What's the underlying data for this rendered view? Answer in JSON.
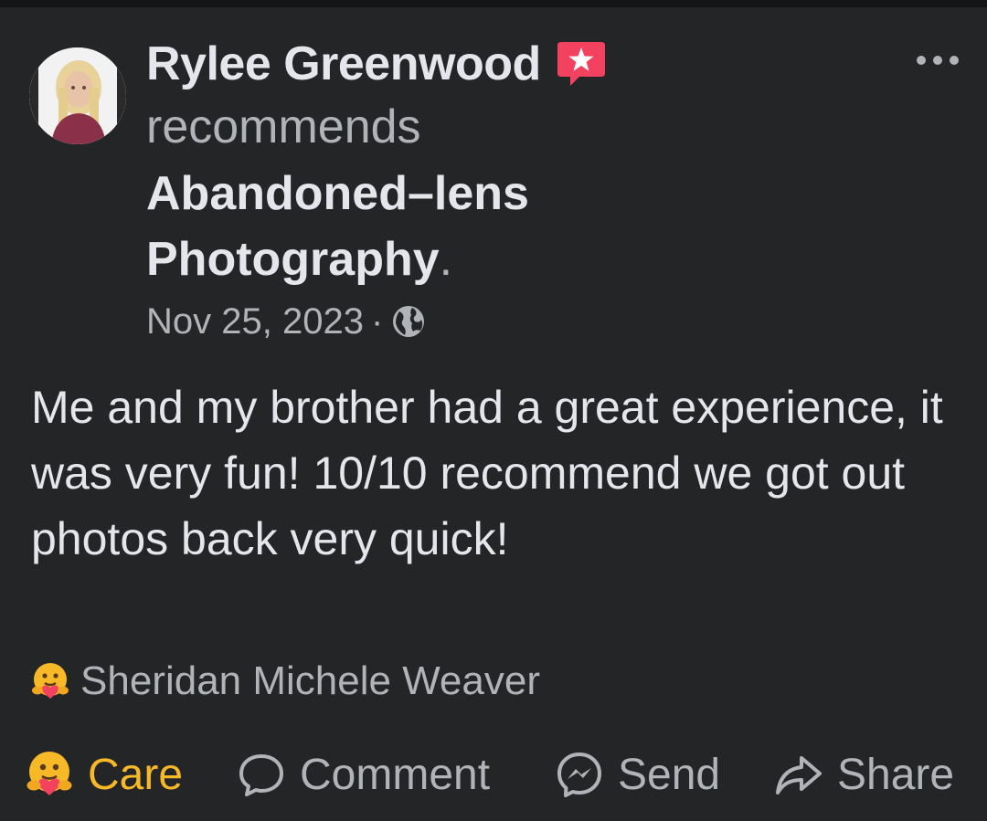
{
  "post": {
    "author": "Rylee Greenwood",
    "verb": "recommends",
    "page": "Abandoned–lens Photography",
    "page_period": ".",
    "date": "Nov 25, 2023",
    "separator": "·",
    "body": "Me and my brother had a great experience, it was very fun! 10/10 recommend we got out photos back very quick!"
  },
  "reactions": {
    "reactor": "Sheridan Michele Weaver"
  },
  "actions": {
    "care": "Care",
    "comment": "Comment",
    "send": "Send",
    "share": "Share"
  },
  "colors": {
    "background": "#242526",
    "primary_text": "#e4e6eb",
    "secondary_text": "#b0b3b8",
    "care_accent": "#f7b928",
    "recommend_badge": "#f3425f"
  },
  "icons": {
    "recommend_badge": "recommend-star-icon",
    "privacy": "globe-icon",
    "more": "more-options-icon",
    "reaction": "care-emoji-icon",
    "comment": "comment-icon",
    "send": "messenger-icon",
    "share": "share-icon"
  }
}
